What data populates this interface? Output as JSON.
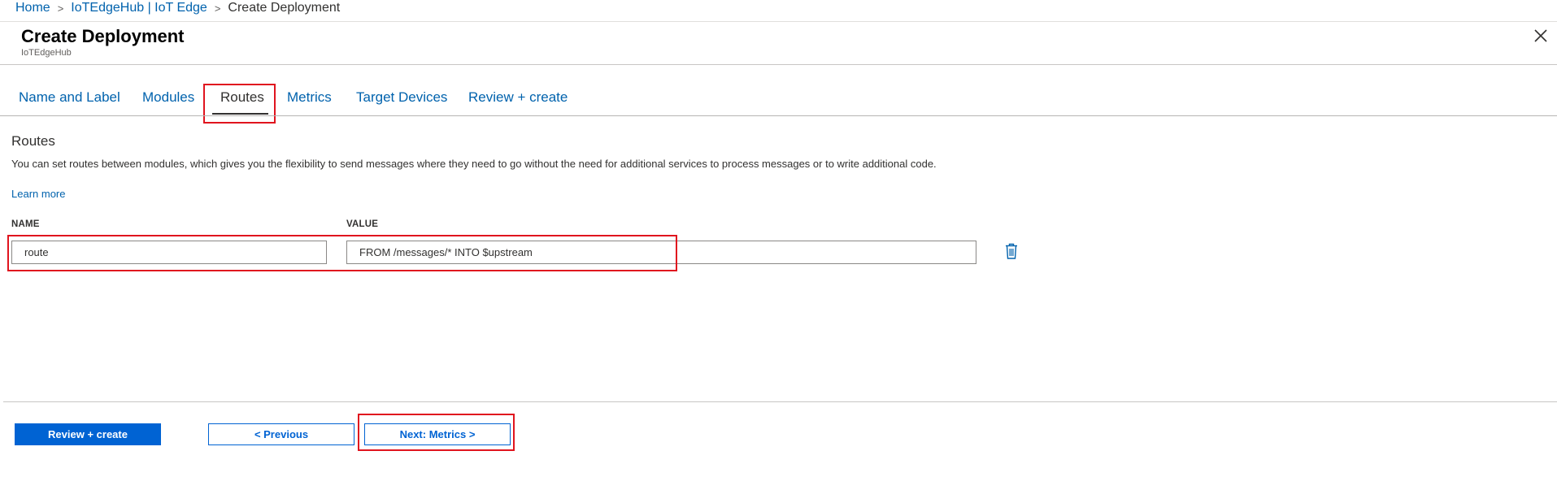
{
  "breadcrumb": {
    "home": "Home",
    "hub": "IoTEdgeHub | IoT Edge",
    "current": "Create Deployment",
    "separator": ">"
  },
  "header": {
    "title": "Create Deployment",
    "subtitle": "IoTEdgeHub",
    "close_icon": "close-icon"
  },
  "tabs": [
    {
      "label": "Name and Label",
      "active": false
    },
    {
      "label": "Modules",
      "active": false
    },
    {
      "label": "Routes",
      "active": true
    },
    {
      "label": "Metrics",
      "active": false
    },
    {
      "label": "Target Devices",
      "active": false
    },
    {
      "label": "Review + create",
      "active": false
    }
  ],
  "routes": {
    "title": "Routes",
    "description": "You can set routes between modules, which gives you the flexibility to send messages where they need to go without the need for additional services to process messages or to write additional code.",
    "learn_more": "Learn more",
    "name_header": "NAME",
    "value_header": "VALUE",
    "rows": [
      {
        "name": "route",
        "value": "FROM /messages/* INTO $upstream",
        "delete_icon": "trash-icon"
      }
    ]
  },
  "footer": {
    "review_create": "Review + create",
    "previous": "< Previous",
    "next": "Next: Metrics >"
  },
  "colors": {
    "link": "#0062ad",
    "primary_button": "#0063d3",
    "highlight": "#e0141e"
  }
}
